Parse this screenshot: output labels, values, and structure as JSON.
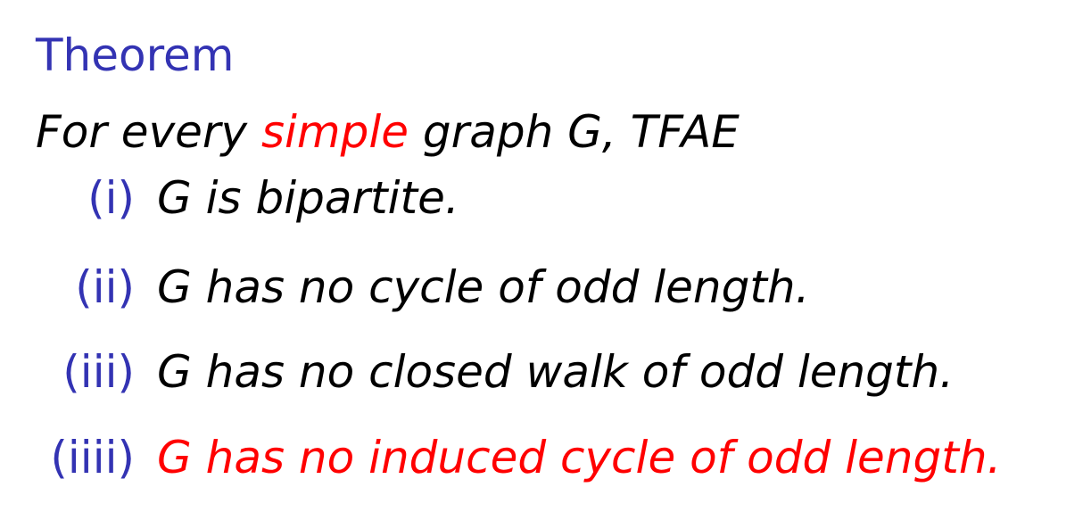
{
  "theorem": {
    "title": "Theorem",
    "intro": {
      "before": "For every ",
      "emphasis": "simple",
      "after": " graph G, TFAE"
    },
    "items": [
      {
        "label": "(i)",
        "text": "G is bipartite."
      },
      {
        "label": "(ii)",
        "text": "G has no cycle of odd length."
      },
      {
        "label": "(iii)",
        "text": "G has no closed walk of odd length."
      },
      {
        "label": "(iiii)",
        "text": "G has no induced cycle of odd length."
      }
    ]
  },
  "colors": {
    "structure": "#3333b3",
    "highlight": "#ff0000",
    "text": "#000000"
  }
}
